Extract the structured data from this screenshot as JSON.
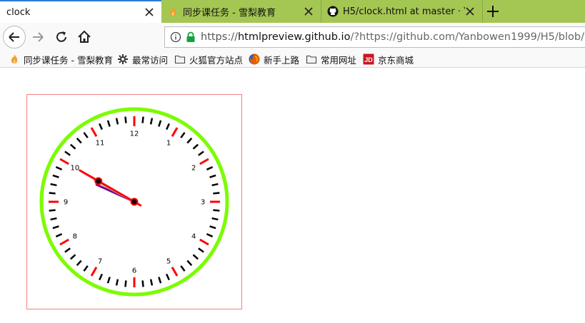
{
  "tabs": [
    {
      "title": "clock",
      "active": true
    },
    {
      "title": "同步课任务 - 雪梨教育",
      "active": false,
      "icon": "flame-icon"
    },
    {
      "title": "H5/clock.html at master · Yanbowen1999/H5",
      "active": false,
      "icon": "github-icon"
    }
  ],
  "address_bar": {
    "url_prefix": "https://",
    "url_host": "htmlpreview.github.io",
    "url_rest": "/?https://github.com/Yanbowen1999/H5/blob/master/clock.html"
  },
  "bookmarks": [
    {
      "label": "同步课任务 - 雪梨教育",
      "icon": "flame-icon"
    },
    {
      "label": "最常访问",
      "icon": "gear-icon"
    },
    {
      "label": "火狐官方站点",
      "icon": "folder-icon"
    },
    {
      "label": "新手上路",
      "icon": "firefox-icon"
    },
    {
      "label": "常用网址",
      "icon": "folder-icon"
    },
    {
      "label": "京东商城",
      "icon": "jd-icon"
    }
  ],
  "clock": {
    "hour_numbers": [
      "12",
      "1",
      "2",
      "3",
      "4",
      "5",
      "6",
      "7",
      "8",
      "9",
      "10",
      "11"
    ],
    "time_shown": {
      "hour": 9,
      "minute": 49,
      "second": 50
    },
    "colors": {
      "rim": "#7cfc00",
      "hour_tick": "#ff0000",
      "minute_tick": "#000000",
      "hour_hand": "#800080",
      "minute_hand": "#c0c0c0",
      "second_hand": "#ff0000",
      "frame_border": "#f08080"
    }
  }
}
